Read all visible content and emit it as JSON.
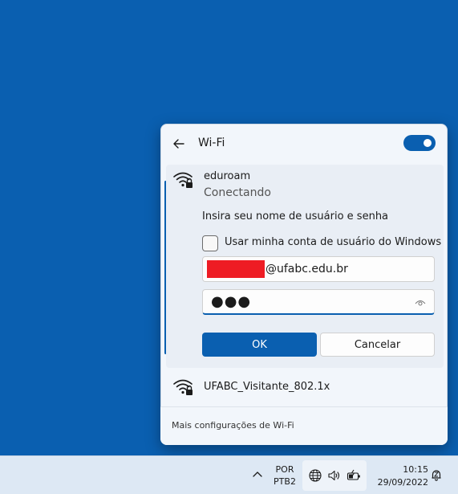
{
  "flyout": {
    "title": "Wi-Fi",
    "wifi_enabled": true,
    "accent_color": "#0a5fb0"
  },
  "networks": [
    {
      "name": "eduroam",
      "status": "Conectando",
      "secured": true,
      "prompt": "Insira seu nome de usuário e senha",
      "use_windows_account_label": "Usar minha conta de usuário do Windows",
      "use_windows_account_checked": false,
      "username_visible_suffix": "@ufabc.edu.br",
      "password_masked": "●●●",
      "ok_label": "OK",
      "cancel_label": "Cancelar"
    },
    {
      "name": "UFABC_Visitante_802.1x",
      "secured": true
    }
  ],
  "footer": {
    "link": "Mais configurações de Wi-Fi"
  },
  "taskbar": {
    "lang_line1": "POR",
    "lang_line2": "PTB2",
    "time": "10:15",
    "date": "29/09/2022"
  }
}
